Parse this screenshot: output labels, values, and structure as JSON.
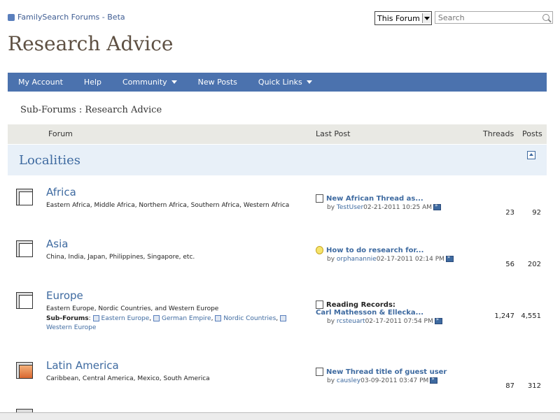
{
  "header": {
    "logo_text": "FamilySearch Forums - Beta",
    "search_scope": "This Forum",
    "search_placeholder": "Search"
  },
  "page_title": "Research Advice",
  "nav": [
    {
      "label": "My Account",
      "has_menu": false
    },
    {
      "label": "Help",
      "has_menu": false
    },
    {
      "label": "Community",
      "has_menu": true
    },
    {
      "label": "New Posts",
      "has_menu": false
    },
    {
      "label": "Quick Links",
      "has_menu": true
    }
  ],
  "breadcrumb": "Sub-Forums : Research Advice",
  "table_headers": {
    "forum": "Forum",
    "last_post": "Last Post",
    "threads": "Threads",
    "posts": "Posts"
  },
  "section": {
    "title": "Localities"
  },
  "forums": [
    {
      "name": "Africa",
      "description": "Eastern Africa, Middle Africa, Northern Africa, Southern Africa, Western Africa",
      "last_post_title": "New African Thread as...",
      "last_post_by": "by ",
      "last_post_user": "TestUser",
      "last_post_date": "02-21-2011",
      "last_post_time": "10:25 AM",
      "threads": "23",
      "posts": "92"
    },
    {
      "name": "Asia",
      "description": "China, India, Japan, Philippines, Singapore, etc.",
      "last_post_title": "How to do research for...",
      "last_post_by": "by ",
      "last_post_user": "orphanannie",
      "last_post_date": "02-17-2011",
      "last_post_time": "02:14 PM",
      "threads": "56",
      "posts": "202"
    },
    {
      "name": "Europe",
      "description": "Eastern Europe, Nordic Countries, and Western Europe",
      "subforums_label": "Sub-Forums",
      "subforums": [
        "Eastern Europe",
        "German Empire",
        "Nordic Countries",
        "Western Europe"
      ],
      "last_post_title_line1": "Reading Records:",
      "last_post_title_line2": "Carl Mathesson & Ellecka...",
      "last_post_by": "by ",
      "last_post_user": "rcsteuart",
      "last_post_date": "02-17-2011",
      "last_post_time": "07:54 PM",
      "threads": "1,247",
      "posts": "4,551"
    },
    {
      "name": "Latin America",
      "description": "Caribbean, Central America, Mexico, South America",
      "last_post_title": "New Thread title of guest user",
      "last_post_by": "by ",
      "last_post_user": "causley",
      "last_post_date": "03-09-2011",
      "last_post_time": "03:47 PM",
      "threads": "87",
      "posts": "312"
    }
  ],
  "colors": {
    "nav_bg": "#4b72ae",
    "link": "#3e6aa0",
    "title": "#5e5043",
    "section_bg": "#e8f0f8",
    "header_bg": "#e9e9e4"
  }
}
